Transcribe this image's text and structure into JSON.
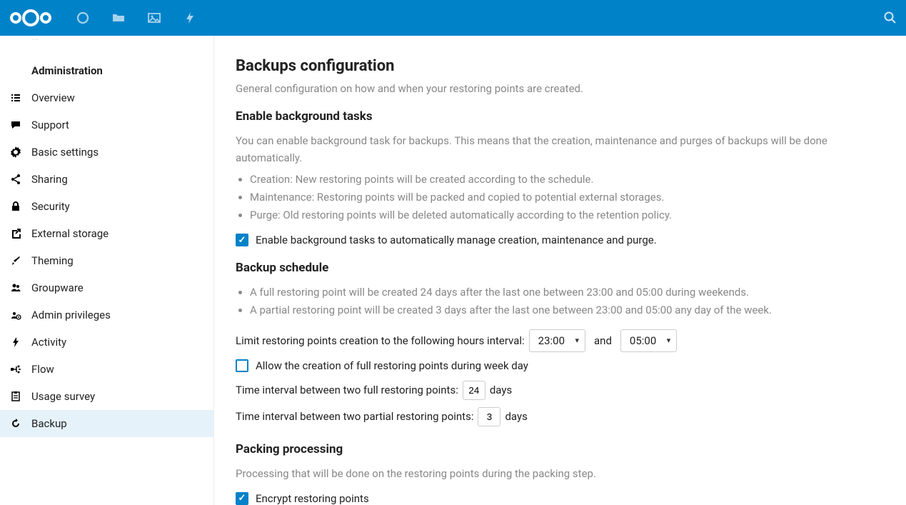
{
  "header": {
    "nav": [
      "dashboard",
      "files",
      "photos",
      "activity"
    ]
  },
  "sidebar": {
    "section": "Administration",
    "items": [
      {
        "label": "Overview",
        "icon": "overview"
      },
      {
        "label": "Support",
        "icon": "support"
      },
      {
        "label": "Basic settings",
        "icon": "settings"
      },
      {
        "label": "Sharing",
        "icon": "share"
      },
      {
        "label": "Security",
        "icon": "lock"
      },
      {
        "label": "External storage",
        "icon": "external"
      },
      {
        "label": "Theming",
        "icon": "brush"
      },
      {
        "label": "Groupware",
        "icon": "group"
      },
      {
        "label": "Admin privileges",
        "icon": "admin"
      },
      {
        "label": "Activity",
        "icon": "bolt"
      },
      {
        "label": "Flow",
        "icon": "flow"
      },
      {
        "label": "Usage survey",
        "icon": "survey"
      },
      {
        "label": "Backup",
        "icon": "backup",
        "active": true
      }
    ]
  },
  "main": {
    "title": "Backups configuration",
    "subtitle": "General configuration on how and when your restoring points are created.",
    "bg": {
      "heading": "Enable background tasks",
      "desc": "You can enable background task for backups. This means that the creation, maintenance and purges of backups will be done automatically.",
      "bullets": [
        "Creation: New restoring points will be created according to the schedule.",
        "Maintenance: Restoring points will be packed and copied to potential external storages.",
        "Purge: Old restoring points will be deleted automatically according to the retention policy."
      ],
      "cb_label": "Enable background tasks to automatically manage creation, maintenance and purge.",
      "cb_checked": true
    },
    "schedule": {
      "heading": "Backup schedule",
      "bullets": [
        "A full restoring point will be created 24 days after the last one between 23:00 and 05:00 during weekends.",
        "A partial restoring point will be created 3 days after the last one between 23:00 and 05:00 any day of the week."
      ],
      "limit_label": "Limit restoring points creation to the following hours interval:",
      "from": "23:00",
      "and": "and",
      "to": "05:00",
      "weekday_cb": "Allow the creation of full restoring points during week day",
      "weekday_checked": false,
      "full_label": "Time interval between two full restoring points:",
      "full_value": "24",
      "full_unit": "days",
      "partial_label": "Time interval between two partial restoring points:",
      "partial_value": "3",
      "partial_unit": "days"
    },
    "packing": {
      "heading": "Packing processing",
      "desc": "Processing that will be done on the restoring points during the packing step.",
      "encrypt_label": "Encrypt restoring points",
      "encrypt_checked": true
    }
  }
}
